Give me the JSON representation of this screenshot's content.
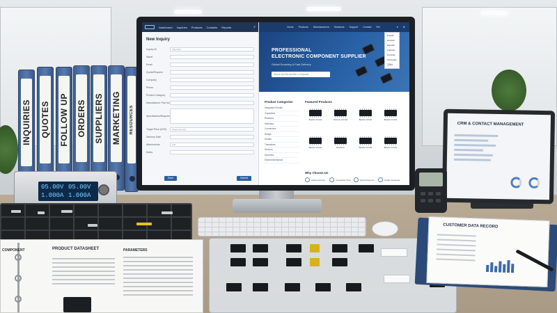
{
  "binders": [
    "INQUIRIES",
    "QUOTES",
    "FOLLOW UP",
    "ORDERS",
    "SUPPLIERS",
    "MARKETING",
    "RESOURCES"
  ],
  "psu": {
    "line1": "05.00V 1.000A",
    "line2": "05.00V 1.000A"
  },
  "inquiry_app": {
    "nav": [
      "Dashboard",
      "Inquiries",
      "Products",
      "Contacts",
      "Reports"
    ],
    "form_title": "New Inquiry",
    "fields": [
      {
        "label": "Inquiry ID",
        "value": "INQ-2024"
      },
      {
        "label": "Name",
        "value": ""
      },
      {
        "label": "Email",
        "value": ""
      },
      {
        "label": "Quote/Request",
        "value": ""
      },
      {
        "label": "Company",
        "value": ""
      },
      {
        "label": "Phone",
        "value": ""
      },
      {
        "label": "Product Category",
        "value": ""
      },
      {
        "label": "Manufacturer Part No.",
        "value": ""
      },
      {
        "label": "Specification/Requirement",
        "value": ""
      },
      {
        "label": "Target Price (USD)",
        "value": "Target Quantity"
      },
      {
        "label": "Delivery Date",
        "value": ""
      },
      {
        "label": "Attachments",
        "value": "Add"
      },
      {
        "label": "Notes",
        "value": ""
      }
    ],
    "cancel_label": "Save",
    "submit_label": "Submit"
  },
  "website": {
    "nav": [
      "Home",
      "Products",
      "Manufacturers",
      "Solutions",
      "Support",
      "Contact",
      "EN"
    ],
    "hero_title_1": "PROFESSIONAL",
    "hero_title_2": "ELECTRONIC COMPONENT SUPPLIER",
    "hero_subtitle": "Global Sourcing & Fast Delivery",
    "search_placeholder": "Search by Part Number or Keyword",
    "languages": [
      "English",
      "Deutsch",
      "Español",
      "Français",
      "Русский",
      "Português",
      "한국어"
    ],
    "categories_title": "Product Categories",
    "categories": [
      "Integrated Circuits",
      "Capacitors",
      "Resistors",
      "Inductors",
      "Connectors",
      "Relays",
      "Diodes",
      "Transistors",
      "Sensors",
      "Discretes",
      "Electromechanical"
    ],
    "featured_title": "Featured Products",
    "products": [
      "Bipolar Circuits",
      "Discrete Circuits",
      "Bipolar Circuits",
      "Bipolar Circuits",
      "Bipolar Circuits",
      "Resistors",
      "Bipolar Circuits",
      "Bipolar Circuits"
    ],
    "why_title": "Why Choose Us",
    "why_items": [
      "Global Sourcing",
      "Competitive Price",
      "Quick Response",
      "Quality Guarantee"
    ]
  },
  "tablet": {
    "title": "CRM & CONTACT MANAGEMENT"
  },
  "datasheet": {
    "title_left": "COMPONENT",
    "title_main": "PRODUCT DATASHEET",
    "title_right": "PARAMETERS"
  },
  "record": {
    "title": "CUSTOMER DATA RECORD"
  },
  "colors": {
    "brand_blue": "#1a3b6b",
    "binder_blue": "#4a6ea3",
    "hero_blue": "#2a63a8"
  }
}
